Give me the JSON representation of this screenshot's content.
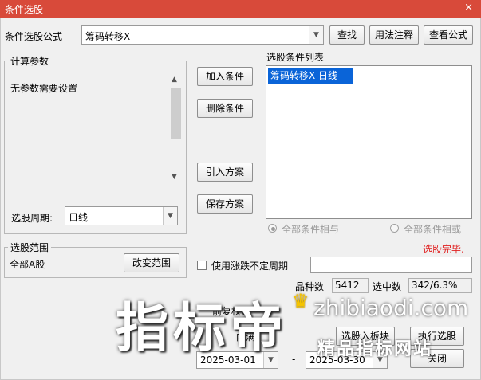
{
  "window": {
    "title": "条件选股",
    "close_glyph": "×"
  },
  "formula": {
    "label": "条件选股公式",
    "value": "筹码转移X  -",
    "buttons": {
      "find": "查找",
      "usage": "用法注释",
      "view": "查看公式"
    }
  },
  "params": {
    "title": "计算参数",
    "message": "无参数需要设置",
    "period_label": "选股周期:",
    "period_value": "日线"
  },
  "actions": {
    "add": "加入条件",
    "delete": "删除条件",
    "import": "引入方案",
    "save": "保存方案"
  },
  "condition_list": {
    "title": "选股条件列表",
    "items": [
      "筹码转移X  日线"
    ]
  },
  "logic": {
    "and_label": "全部条件相与",
    "or_label": "全部条件相或"
  },
  "status": {
    "text": "选股完毕.",
    "color": "#e02020"
  },
  "range": {
    "title": "选股范围",
    "value": "全部A股",
    "change_button": "改变范围"
  },
  "options": {
    "use_irregular_label": "使用涨跌不定周期"
  },
  "stats": {
    "count_label": "品种数",
    "count_value": "5412",
    "selected_label": "选中数",
    "selected_value": "342/6.3%"
  },
  "partial": {
    "pre_label": "前复权数",
    "range_label": "内满"
  },
  "dates": {
    "start": "2025-03-01",
    "sep": "-",
    "end": "2025-03-30"
  },
  "bottom_buttons": {
    "to_block": "选股入板块",
    "execute": "执行选股",
    "close": "关闭"
  },
  "watermark": {
    "big": "指标帝",
    "url": "zhibiaodi.com",
    "sub": "精品指标网站",
    "crown": "♛"
  }
}
